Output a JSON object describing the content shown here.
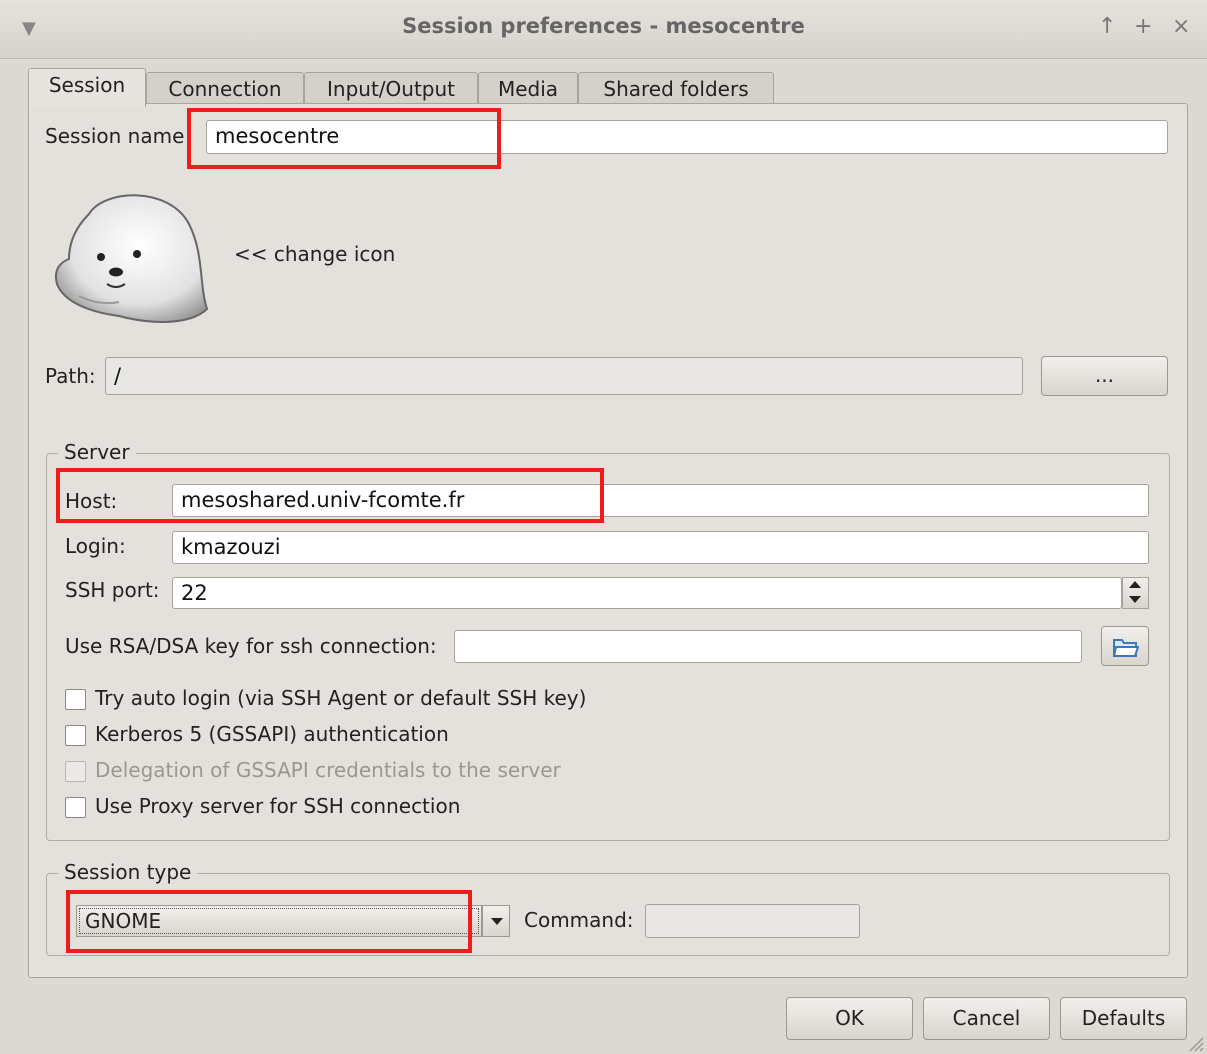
{
  "window": {
    "title": "Session preferences - mesocentre",
    "buttons": [
      "↑",
      "+",
      "×"
    ]
  },
  "tabs": [
    {
      "label": "Session",
      "active": true
    },
    {
      "label": "Connection",
      "active": false
    },
    {
      "label": "Input/Output",
      "active": false
    },
    {
      "label": "Media",
      "active": false
    },
    {
      "label": "Shared folders",
      "active": false
    }
  ],
  "session": {
    "name_label": "Session name",
    "name_value": "mesocentre",
    "change_icon": "<< change icon",
    "path_label": "Path:",
    "path_value": "/",
    "browse_label": "..."
  },
  "server": {
    "legend": "Server",
    "host_label": "Host:",
    "host_value": "mesoshared.univ-fcomte.fr",
    "login_label": "Login:",
    "login_value": "kmazouzi",
    "port_label": "SSH port:",
    "port_value": "22",
    "rsa_label": "Use RSA/DSA key for ssh connection:",
    "rsa_value": "",
    "checkboxes": [
      {
        "label": "Try auto login (via SSH Agent or default SSH key)",
        "checked": false,
        "enabled": true
      },
      {
        "label": "Kerberos 5 (GSSAPI) authentication",
        "checked": false,
        "enabled": true
      },
      {
        "label": "Delegation of GSSAPI credentials to the server",
        "checked": false,
        "enabled": false
      },
      {
        "label": "Use Proxy server for SSH connection",
        "checked": false,
        "enabled": true
      }
    ]
  },
  "session_type": {
    "legend": "Session type",
    "selected": "GNOME",
    "command_label": "Command:",
    "command_value": ""
  },
  "footer": {
    "ok": "OK",
    "cancel": "Cancel",
    "defaults": "Defaults"
  },
  "colors": {
    "highlight": "#ee1c1c",
    "window_bg": "#dcd8d2"
  },
  "icons": [
    "seal-icon",
    "folder-open-icon",
    "spin-arrows-icon",
    "dropdown-arrow-icon",
    "resize-grip-icon"
  ]
}
